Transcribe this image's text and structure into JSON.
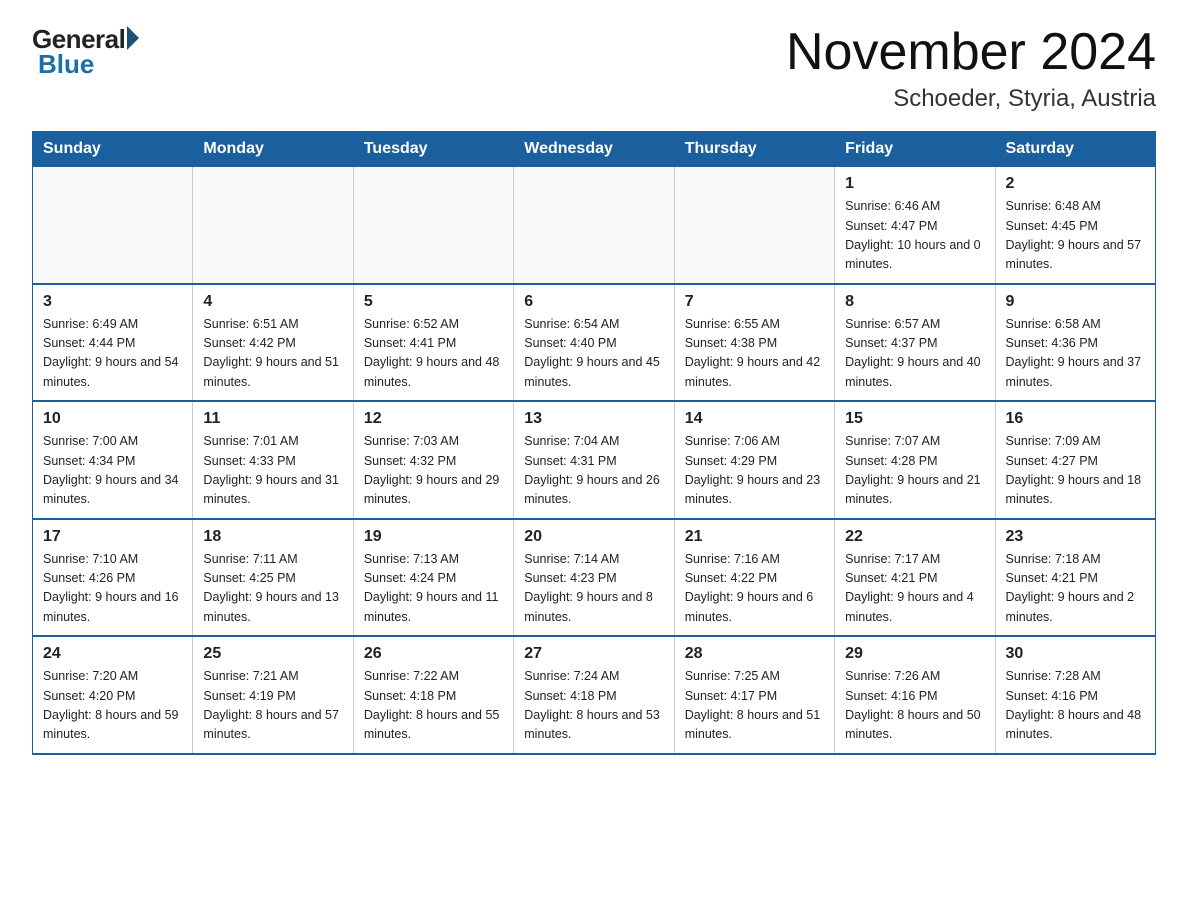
{
  "logo": {
    "general": "General",
    "blue": "Blue"
  },
  "title": "November 2024",
  "subtitle": "Schoeder, Styria, Austria",
  "days_of_week": [
    "Sunday",
    "Monday",
    "Tuesday",
    "Wednesday",
    "Thursday",
    "Friday",
    "Saturday"
  ],
  "weeks": [
    [
      {
        "day": "",
        "info": ""
      },
      {
        "day": "",
        "info": ""
      },
      {
        "day": "",
        "info": ""
      },
      {
        "day": "",
        "info": ""
      },
      {
        "day": "",
        "info": ""
      },
      {
        "day": "1",
        "info": "Sunrise: 6:46 AM\nSunset: 4:47 PM\nDaylight: 10 hours\nand 0 minutes."
      },
      {
        "day": "2",
        "info": "Sunrise: 6:48 AM\nSunset: 4:45 PM\nDaylight: 9 hours\nand 57 minutes."
      }
    ],
    [
      {
        "day": "3",
        "info": "Sunrise: 6:49 AM\nSunset: 4:44 PM\nDaylight: 9 hours\nand 54 minutes."
      },
      {
        "day": "4",
        "info": "Sunrise: 6:51 AM\nSunset: 4:42 PM\nDaylight: 9 hours\nand 51 minutes."
      },
      {
        "day": "5",
        "info": "Sunrise: 6:52 AM\nSunset: 4:41 PM\nDaylight: 9 hours\nand 48 minutes."
      },
      {
        "day": "6",
        "info": "Sunrise: 6:54 AM\nSunset: 4:40 PM\nDaylight: 9 hours\nand 45 minutes."
      },
      {
        "day": "7",
        "info": "Sunrise: 6:55 AM\nSunset: 4:38 PM\nDaylight: 9 hours\nand 42 minutes."
      },
      {
        "day": "8",
        "info": "Sunrise: 6:57 AM\nSunset: 4:37 PM\nDaylight: 9 hours\nand 40 minutes."
      },
      {
        "day": "9",
        "info": "Sunrise: 6:58 AM\nSunset: 4:36 PM\nDaylight: 9 hours\nand 37 minutes."
      }
    ],
    [
      {
        "day": "10",
        "info": "Sunrise: 7:00 AM\nSunset: 4:34 PM\nDaylight: 9 hours\nand 34 minutes."
      },
      {
        "day": "11",
        "info": "Sunrise: 7:01 AM\nSunset: 4:33 PM\nDaylight: 9 hours\nand 31 minutes."
      },
      {
        "day": "12",
        "info": "Sunrise: 7:03 AM\nSunset: 4:32 PM\nDaylight: 9 hours\nand 29 minutes."
      },
      {
        "day": "13",
        "info": "Sunrise: 7:04 AM\nSunset: 4:31 PM\nDaylight: 9 hours\nand 26 minutes."
      },
      {
        "day": "14",
        "info": "Sunrise: 7:06 AM\nSunset: 4:29 PM\nDaylight: 9 hours\nand 23 minutes."
      },
      {
        "day": "15",
        "info": "Sunrise: 7:07 AM\nSunset: 4:28 PM\nDaylight: 9 hours\nand 21 minutes."
      },
      {
        "day": "16",
        "info": "Sunrise: 7:09 AM\nSunset: 4:27 PM\nDaylight: 9 hours\nand 18 minutes."
      }
    ],
    [
      {
        "day": "17",
        "info": "Sunrise: 7:10 AM\nSunset: 4:26 PM\nDaylight: 9 hours\nand 16 minutes."
      },
      {
        "day": "18",
        "info": "Sunrise: 7:11 AM\nSunset: 4:25 PM\nDaylight: 9 hours\nand 13 minutes."
      },
      {
        "day": "19",
        "info": "Sunrise: 7:13 AM\nSunset: 4:24 PM\nDaylight: 9 hours\nand 11 minutes."
      },
      {
        "day": "20",
        "info": "Sunrise: 7:14 AM\nSunset: 4:23 PM\nDaylight: 9 hours\nand 8 minutes."
      },
      {
        "day": "21",
        "info": "Sunrise: 7:16 AM\nSunset: 4:22 PM\nDaylight: 9 hours\nand 6 minutes."
      },
      {
        "day": "22",
        "info": "Sunrise: 7:17 AM\nSunset: 4:21 PM\nDaylight: 9 hours\nand 4 minutes."
      },
      {
        "day": "23",
        "info": "Sunrise: 7:18 AM\nSunset: 4:21 PM\nDaylight: 9 hours\nand 2 minutes."
      }
    ],
    [
      {
        "day": "24",
        "info": "Sunrise: 7:20 AM\nSunset: 4:20 PM\nDaylight: 8 hours\nand 59 minutes."
      },
      {
        "day": "25",
        "info": "Sunrise: 7:21 AM\nSunset: 4:19 PM\nDaylight: 8 hours\nand 57 minutes."
      },
      {
        "day": "26",
        "info": "Sunrise: 7:22 AM\nSunset: 4:18 PM\nDaylight: 8 hours\nand 55 minutes."
      },
      {
        "day": "27",
        "info": "Sunrise: 7:24 AM\nSunset: 4:18 PM\nDaylight: 8 hours\nand 53 minutes."
      },
      {
        "day": "28",
        "info": "Sunrise: 7:25 AM\nSunset: 4:17 PM\nDaylight: 8 hours\nand 51 minutes."
      },
      {
        "day": "29",
        "info": "Sunrise: 7:26 AM\nSunset: 4:16 PM\nDaylight: 8 hours\nand 50 minutes."
      },
      {
        "day": "30",
        "info": "Sunrise: 7:28 AM\nSunset: 4:16 PM\nDaylight: 8 hours\nand 48 minutes."
      }
    ]
  ]
}
